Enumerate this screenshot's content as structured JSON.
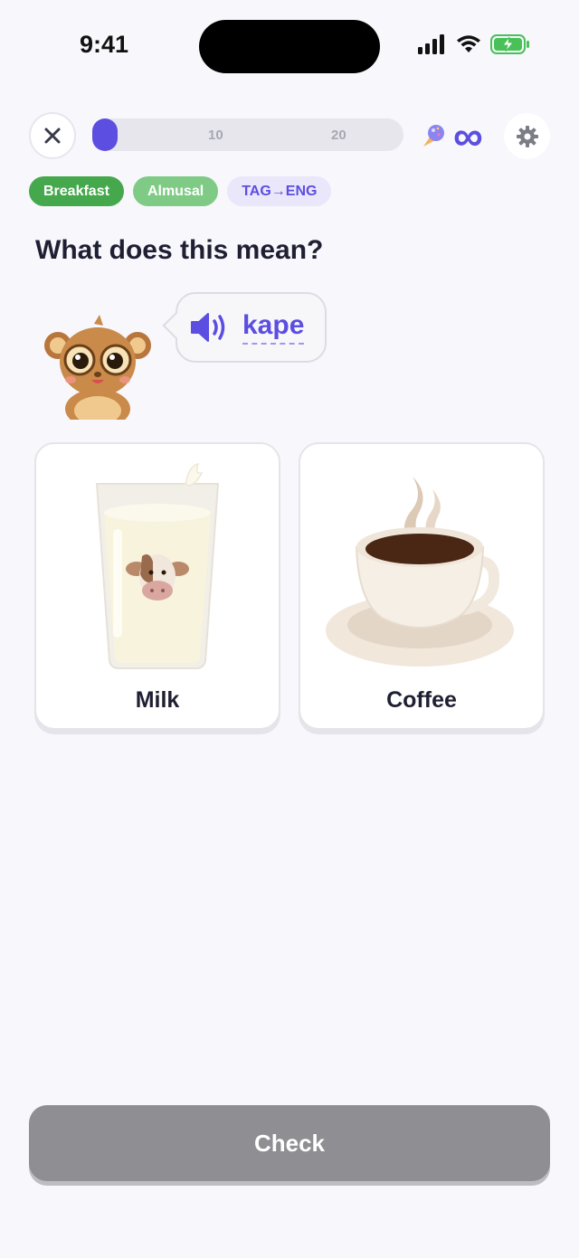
{
  "status_bar": {
    "time": "9:41"
  },
  "top_bar": {
    "progress": {
      "current": 1,
      "ticks": [
        "10",
        "20"
      ]
    },
    "hearts_text": "∞"
  },
  "tags": [
    "Breakfast",
    "Almusal",
    "TAG→ENG"
  ],
  "prompt": "What does this mean?",
  "word": "kape",
  "options": [
    {
      "label": "Milk",
      "icon": "milk-glass-icon"
    },
    {
      "label": "Coffee",
      "icon": "coffee-cup-icon"
    }
  ],
  "check_button": "Check",
  "colors": {
    "accent": "#5b4ee0",
    "tag_green": "#46a84c",
    "tag_light_green": "#7fcb85",
    "button_disabled": "#8e8e93"
  }
}
